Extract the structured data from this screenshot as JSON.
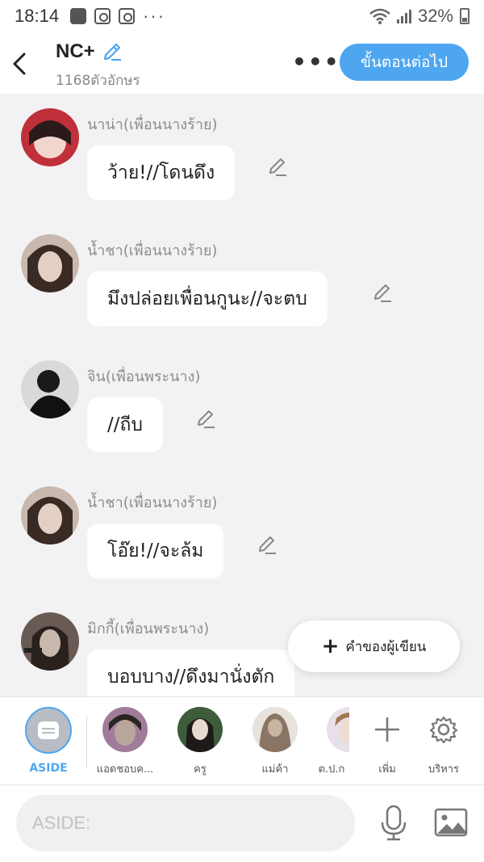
{
  "status_bar": {
    "time": "18:14",
    "battery": "32%",
    "more": "···"
  },
  "header": {
    "title": "NC+",
    "char_count": "1168ตัวอักษร",
    "next_button": "ขั้นตอนต่อไป",
    "more": "•••"
  },
  "messages": [
    {
      "sender": "นาน่า(เพื่อนนางร้าย)",
      "text": "ว้าย!//โดนดึง",
      "avatar_colors": [
        "#c0303a",
        "#f1d6cf"
      ]
    },
    {
      "sender": "น้ำชา(เพื่อนนางร้าย)",
      "text": "มึงปล่อยเพื่อนกูนะ//จะตบ",
      "avatar_colors": [
        "#3a2a24",
        "#e4cfc4"
      ]
    },
    {
      "sender": "จิน(เพื่อนพระนาง)",
      "text": "//ถีบ",
      "avatar_colors": [
        "#1a1a1a",
        "#d9d9d9"
      ]
    },
    {
      "sender": "น้ำชา(เพื่อนนางร้าย)",
      "text": "โอ๊ย!//จะล้ม",
      "avatar_colors": [
        "#3a2a24",
        "#e4cfc4"
      ]
    },
    {
      "sender": "มิกกี้(เพื่อนพระนาง)",
      "text": "บอบบาง//ดึงมานั่งตัก",
      "avatar_colors": [
        "#5a4a44",
        "#c9b8ae"
      ]
    }
  ],
  "fab": {
    "label": "คำของผู้เขียน",
    "icon": "plus-icon"
  },
  "characters": [
    {
      "label": "ASIDE",
      "icon": "aside-icon"
    },
    {
      "label": "แอดชอบค...",
      "colors": [
        "#2a2420",
        "#b8a69a"
      ]
    },
    {
      "label": "ครู",
      "colors": [
        "#3e5c3a",
        "#e6d9cf"
      ]
    },
    {
      "label": "แม่ค้า",
      "colors": [
        "#8a7464",
        "#c9b4a2"
      ]
    },
    {
      "label": "ต.ป.ก",
      "colors": [
        "#a07850",
        "#e8e0e8"
      ]
    }
  ],
  "tools": [
    {
      "label": "เพิ่ม",
      "icon": "plus-icon"
    },
    {
      "label": "บริหาร",
      "icon": "gear-icon"
    }
  ],
  "input": {
    "placeholder": "ASIDE:"
  },
  "colors": {
    "accent": "#4ea6f0",
    "background": "#f2f2f4"
  }
}
